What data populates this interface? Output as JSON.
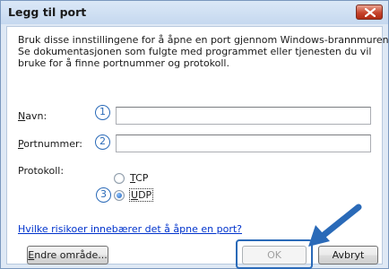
{
  "dialog": {
    "title": "Legg til port",
    "description_lines": [
      "Bruk disse innstillingene for å åpne en port gjennom Windows-brannmuren.",
      "Se dokumentasjonen som fulgte med programmet eller tjenesten du vil",
      "bruke for å finne portnummer og protokoll."
    ]
  },
  "fields": {
    "name_label_key": "N",
    "name_label_rest": "avn:",
    "name_value": "",
    "port_label_key": "P",
    "port_label_rest": "ortnummer:",
    "port_value": ""
  },
  "protocol": {
    "label": "Protokoll:",
    "tcp_key": "T",
    "tcp_rest": "CP",
    "udp_key": "U",
    "udp_rest": "DP",
    "selected": "UDP"
  },
  "annotations": {
    "step1": "1",
    "step2": "2",
    "step3": "3"
  },
  "link_text": "Hvilke risikoer innebærer det å åpne en port?",
  "buttons": {
    "change_scope_key": "E",
    "change_scope_rest": "ndre område...",
    "ok": "OK",
    "cancel": "Avbryt"
  },
  "colors": {
    "annotation": "#2a6ab8",
    "link": "#0033cc",
    "close_button": "#c7452e"
  }
}
